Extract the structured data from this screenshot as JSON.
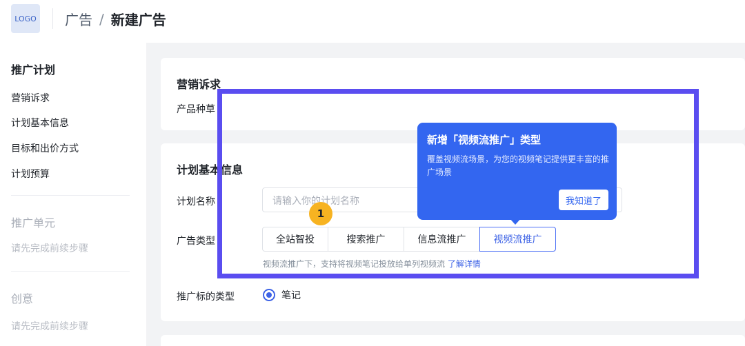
{
  "header": {
    "logo": "LOGO",
    "breadcrumb": [
      "广告",
      "新建广告"
    ],
    "separator": "/"
  },
  "sidebar": {
    "section1_title": "推广计划",
    "items": [
      "营销诉求",
      "计划基本信息",
      "目标和出价方式",
      "计划预算"
    ],
    "section2_title": "推广单元",
    "section2_hint": "请先完成前续步骤",
    "section3_title": "创意",
    "section3_hint": "请先完成前续步骤"
  },
  "marketing": {
    "title": "营销诉求",
    "product_label": "产品种草"
  },
  "plan": {
    "title": "计划基本信息",
    "name_label": "计划名称",
    "name_placeholder": "请输入你的计划名称",
    "type_label": "广告类型",
    "types": [
      "全站智投",
      "搜索推广",
      "信息流推广",
      "视频流推广"
    ],
    "selected_type": "视频流推广",
    "help_text": "视频流推广下，支持将视频笔记投放给单列视频流",
    "help_link": "了解详情",
    "target_label": "推广标的类型",
    "target_option": "笔记"
  },
  "tooltip": {
    "title": "新增「视频流推广」类型",
    "body": "覆盖视频流场景，为您的视频笔记提供更丰富的推广场景",
    "button": "我知道了"
  },
  "step_badge": "1",
  "colors": {
    "accent": "#3e63e6",
    "tooltip_bg": "#3366f0",
    "highlight_border": "#5a4df0",
    "badge": "#f7b321"
  }
}
